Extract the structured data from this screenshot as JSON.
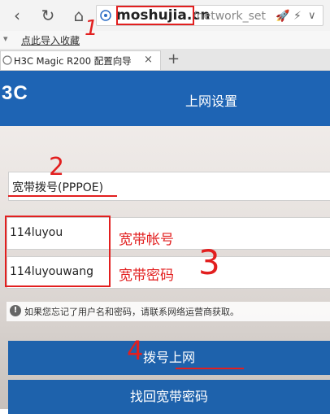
{
  "browser": {
    "url_domain": "moshujia.cn",
    "url_path": "/network_set",
    "bookmarks_import": "点此导入收藏",
    "tab_title": "H3C Magic R200 配置向导",
    "tab_close": "×",
    "new_tab": "+"
  },
  "page": {
    "logo": "3C",
    "header_title": "上网设置",
    "mode_value": "宽带拨号(PPPOE)",
    "username_value": "114luyou",
    "password_value": "114luyouwang",
    "notice": "如果您忘记了用户名和密码，请联系网络运营商获取。",
    "dial_button": "拨号上网",
    "recover_button": "找回宽带密码"
  },
  "annotations": {
    "step1": "1",
    "step2": "2",
    "step3": "3",
    "step4": "4",
    "username_label": "宽带帐号",
    "password_label": "宽带密码",
    "color": "#e21f1f"
  },
  "colors": {
    "brand_blue": "#1e64b4",
    "button_blue": "#1e62ac"
  },
  "icons": [
    "back-icon",
    "refresh-icon",
    "home-icon",
    "globe-icon",
    "rocket-icon",
    "bolt-icon",
    "chevron-down-icon",
    "info-icon"
  ]
}
